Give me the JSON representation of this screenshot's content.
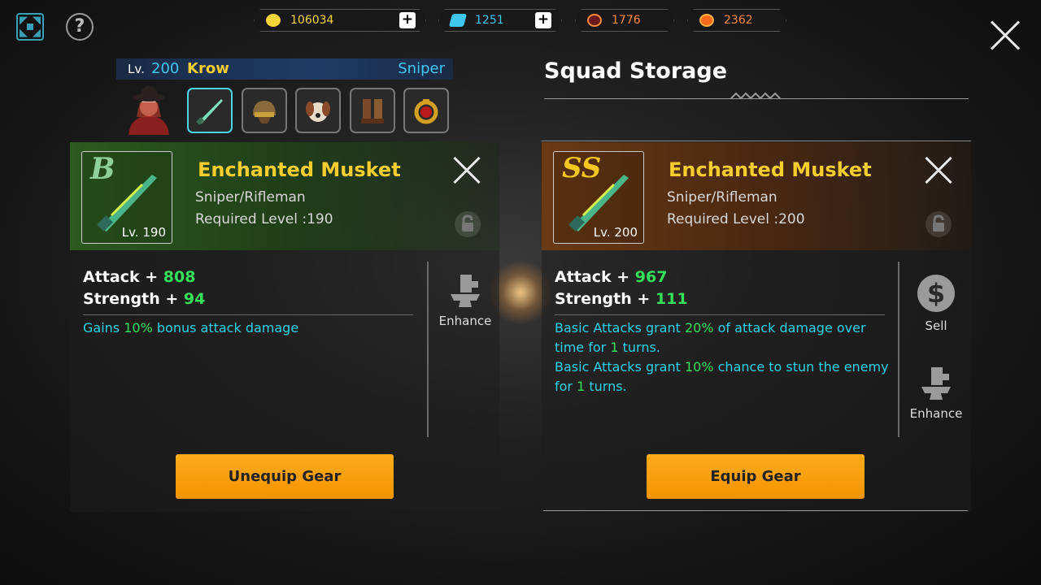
{
  "currencies": [
    {
      "name": "gold",
      "value": "106034",
      "color": "#f5d53a",
      "has_plus": true
    },
    {
      "name": "diamond",
      "value": "1251",
      "color": "#3fc7f0",
      "has_plus": true
    },
    {
      "name": "stamina",
      "value": "1776",
      "color": "#ff8a40",
      "has_plus": false
    },
    {
      "name": "medal",
      "value": "2362",
      "color": "#ff8a40",
      "has_plus": false
    }
  ],
  "help_label": "?",
  "character": {
    "level_prefix": "Lv.",
    "level": "200",
    "name": "Krow",
    "class": "Sniper"
  },
  "equipment_slots": [
    "musket-icon",
    "helmet-icon",
    "pet-icon",
    "boots-icon",
    "ring-icon"
  ],
  "equipped": {
    "grade": "B",
    "level": "Lv. 190",
    "name": "Enchanted Musket",
    "type": "Sniper/Rifleman",
    "required_level": "Required Level :190",
    "stats": [
      {
        "label": "Attack + ",
        "value": "808"
      },
      {
        "label": "Strength + ",
        "value": "94"
      }
    ],
    "effects": [
      {
        "pre": "Gains ",
        "hl": "10%",
        "post": " bonus attack damage"
      }
    ],
    "actions": {
      "enhance": "Enhance"
    },
    "button": "Unequip Gear"
  },
  "storage": {
    "title": "Squad Storage",
    "grade": "SS",
    "level": "Lv. 200",
    "name": "Enchanted Musket",
    "type": "Sniper/Rifleman",
    "required_level": "Required Level :200",
    "stats": [
      {
        "label": "Attack + ",
        "value": "967"
      },
      {
        "label": "Strength + ",
        "value": "111"
      }
    ],
    "effects": [
      {
        "l1_pre": "Basic Attacks grant ",
        "l1_hl": "20%",
        "l1_post": " of attack damage over",
        "l2_pre": "time for ",
        "l2_hl": "1",
        "l2_post": " turns."
      },
      {
        "l1_pre": "Basic Attacks grant ",
        "l1_hl": "10%",
        "l1_post": " chance to stun the enemy",
        "l2_pre": "for ",
        "l2_hl": "1",
        "l2_post": " turns."
      }
    ],
    "actions": {
      "sell": "Sell",
      "enhance": "Enhance"
    },
    "button": "Equip Gear"
  }
}
